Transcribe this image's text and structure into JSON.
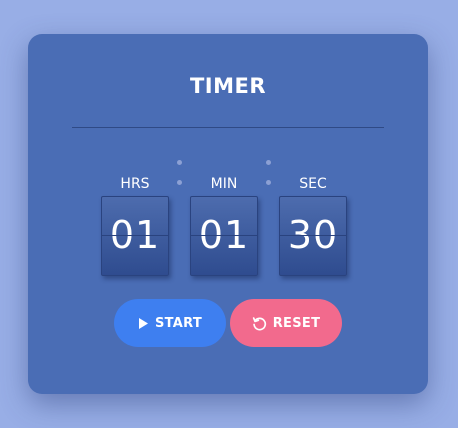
{
  "timer": {
    "title": "TIMER",
    "units": [
      {
        "label": "HRS",
        "value": "01"
      },
      {
        "label": "MIN",
        "value": "01"
      },
      {
        "label": "SEC",
        "value": "30"
      }
    ]
  },
  "controls": {
    "start_label": "START",
    "reset_label": "RESET",
    "start_icon": "play-icon",
    "reset_icon": "reset-icon"
  },
  "colors": {
    "background": "#98aee6",
    "card": "#4a6db5",
    "start_button": "#3e7ff0",
    "reset_button": "#f26a8d"
  }
}
